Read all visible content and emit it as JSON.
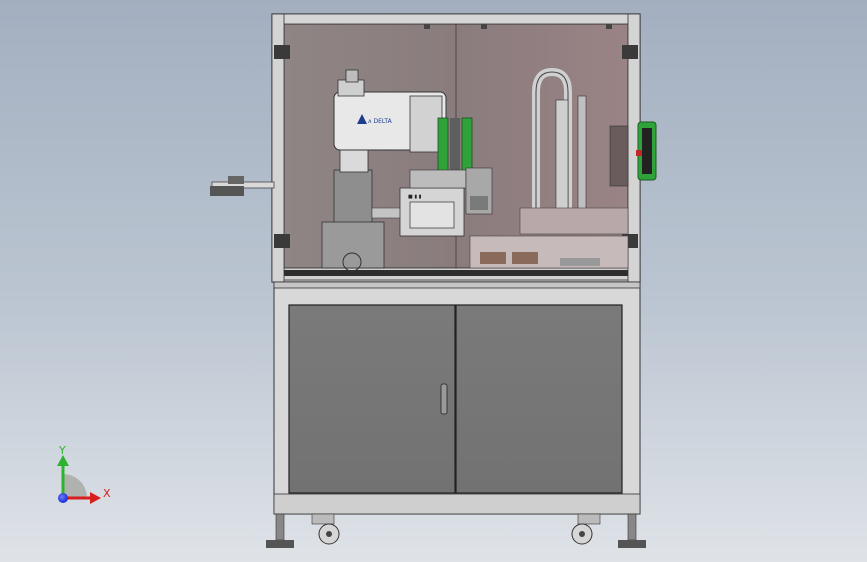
{
  "scene": {
    "colors": {
      "background_top": "#a3afc0",
      "background_bottom": "#dfe3e8",
      "frame": "#c9c9c9",
      "enclosure_glass": "#8c7f7f",
      "cabinet_door": "#777777",
      "cabinet_body": "#d8d8d8",
      "accent_green": "#2fa33a",
      "axis_y": "#2db32d",
      "axis_x": "#d81e1e",
      "axis_origin": "#1a2bd6"
    }
  },
  "machine": {
    "robot_brand_text": "ᴧ DELTA",
    "hmi_label": "■ ▮ ▮"
  },
  "triad": {
    "y_label": "Y",
    "x_label": "X"
  }
}
